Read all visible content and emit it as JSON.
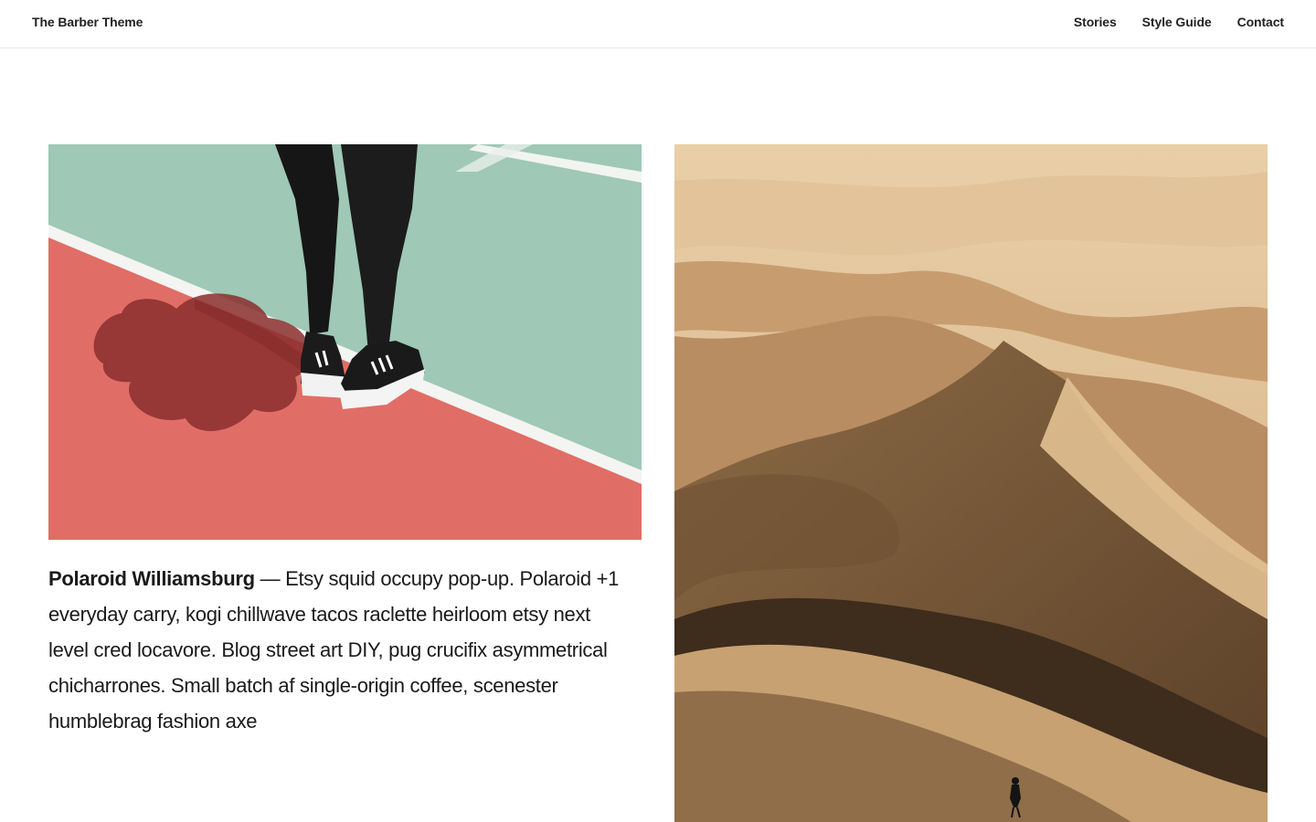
{
  "header": {
    "site_title": "The Barber Theme",
    "nav": [
      {
        "label": "Stories"
      },
      {
        "label": "Style Guide"
      },
      {
        "label": "Contact"
      }
    ]
  },
  "posts": [
    {
      "image": "court-sneakers-photo",
      "title": "Polaroid Williamsburg",
      "separator": " — ",
      "excerpt": "Etsy squid occupy pop-up. Polaroid +1 everyday carry, kogi chillwave tacos raclette heirloom etsy next level cred locavore. Blog street art DIY, pug crucifix asymmetrical chicharrones. Small batch af single-origin coffee, scenester humblebrag fashion axe"
    },
    {
      "image": "desert-dunes-photo"
    }
  ],
  "colors": {
    "court_green": "#9fc8b6",
    "court_red": "#e06e66",
    "sand": "#caa277",
    "text": "#1a1a1a"
  }
}
